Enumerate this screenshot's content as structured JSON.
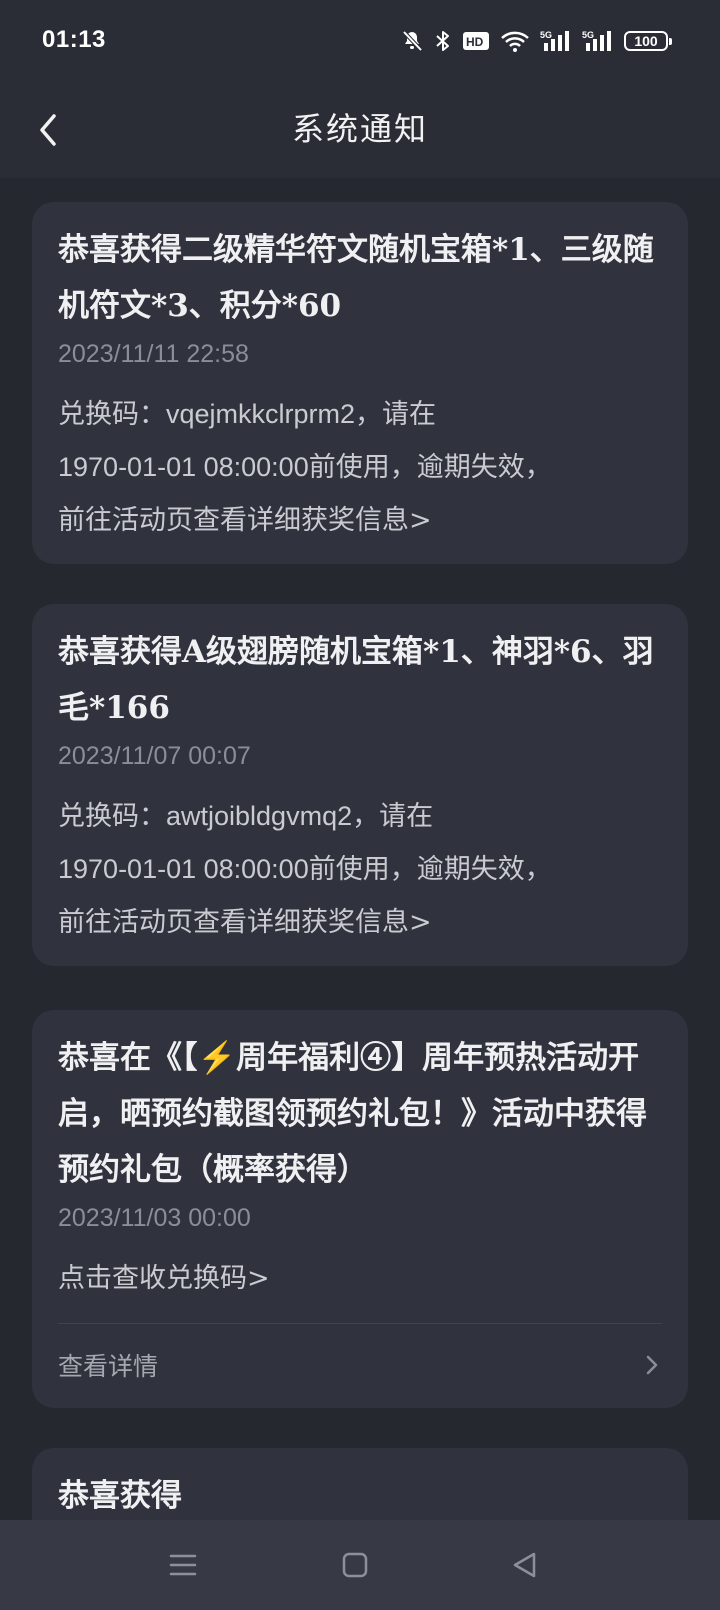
{
  "status_bar": {
    "time": "01:13",
    "battery": "100",
    "icons": [
      "mute-bell-icon",
      "bluetooth-icon",
      "hd-voice-icon",
      "wifi-icon",
      "signal-5g-icon",
      "signal-5g-icon",
      "battery-icon"
    ]
  },
  "header": {
    "title": "系统通知",
    "back_icon": "chevron-left-icon"
  },
  "notifications": [
    {
      "title": "恭喜获得二级精华符文随机宝箱*1、三级随机符文*3、积分*60",
      "time": "2023/11/11 22:58",
      "body_prefix": "兑换码：",
      "code": "vqejmkkclrprm2",
      "body_suffix": "，请在",
      "body_line2": "1970-01-01 08:00:00前使用，逾期失效，",
      "body_line3": "前往活动页查看详细获奖信息>"
    },
    {
      "title": "恭喜获得A级翅膀随机宝箱*1、神羽*6、羽毛*166",
      "time": "2023/11/07 00:07",
      "body_prefix": "兑换码：",
      "code": "awtjoibldgvmq2",
      "body_suffix": "，请在",
      "body_line2": "1970-01-01 08:00:00前使用，逾期失效，",
      "body_line3": "前往活动页查看详细获奖信息>"
    },
    {
      "title": "恭喜在《【⚡周年福利④】周年预热活动开启，晒预约截图领预约礼包！》活动中获得预约礼包（概率获得）",
      "time": "2023/11/03 00:00",
      "body": "点击查收兑换码>",
      "detail_label": "查看详情",
      "detail_icon": "chevron-right-icon"
    }
  ],
  "partial_card_title": "恭喜获得",
  "nav_bar": {
    "icons": [
      "menu-icon",
      "home-square-icon",
      "back-triangle-icon"
    ]
  },
  "colors": {
    "background": "#262830",
    "card": "#30333d",
    "text_primary": "#f0f0f2",
    "text_secondary": "#8b8e97",
    "nav_bar": "#373a44"
  }
}
